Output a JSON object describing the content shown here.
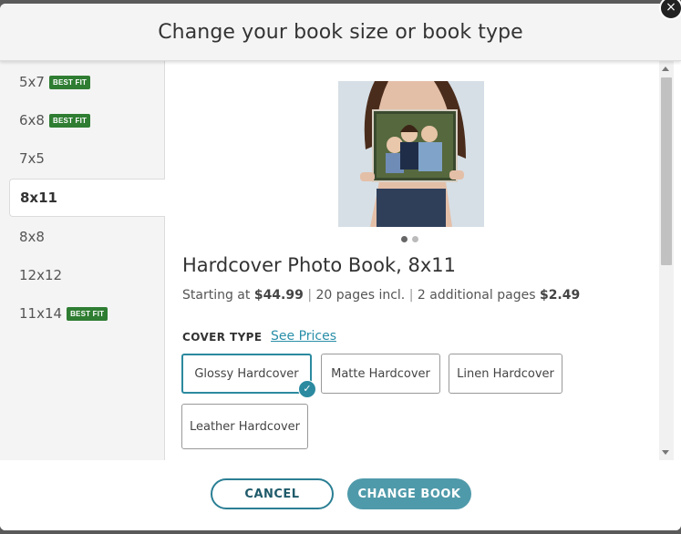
{
  "header": {
    "title": "Change your book size or book type",
    "close_symbol": "×"
  },
  "sidebar": {
    "items": [
      {
        "label": "5x7",
        "badge": "BEST FIT"
      },
      {
        "label": "6x8",
        "badge": "BEST FIT"
      },
      {
        "label": "7x5"
      },
      {
        "label": "8x11",
        "selected": true
      },
      {
        "label": "8x8"
      },
      {
        "label": "12x12"
      },
      {
        "label": "11x14",
        "badge": "BEST FIT"
      }
    ]
  },
  "product": {
    "title": "Hardcover Photo Book, 8x11",
    "starting_at": "Starting at",
    "price": "$44.99",
    "pages_included": "20 pages incl.",
    "additional_pages": "2 additional pages",
    "additional_price": "$2.49",
    "separator": "|",
    "carousel_count": 2,
    "carousel_active": 1
  },
  "cover": {
    "label": "COVER TYPE",
    "see_prices": "See Prices",
    "options": [
      {
        "label": "Glossy Hardcover",
        "selected": true
      },
      {
        "label": "Matte Hardcover"
      },
      {
        "label": "Linen Hardcover"
      },
      {
        "label": "Leather Hardcover"
      }
    ],
    "check_symbol": "✓"
  },
  "footer": {
    "cancel": "CANCEL",
    "change": "CHANGE BOOK"
  },
  "colors": {
    "accent": "#2b8a9f",
    "badge": "#2e7d32",
    "primary_button": "#4f9aaa"
  }
}
